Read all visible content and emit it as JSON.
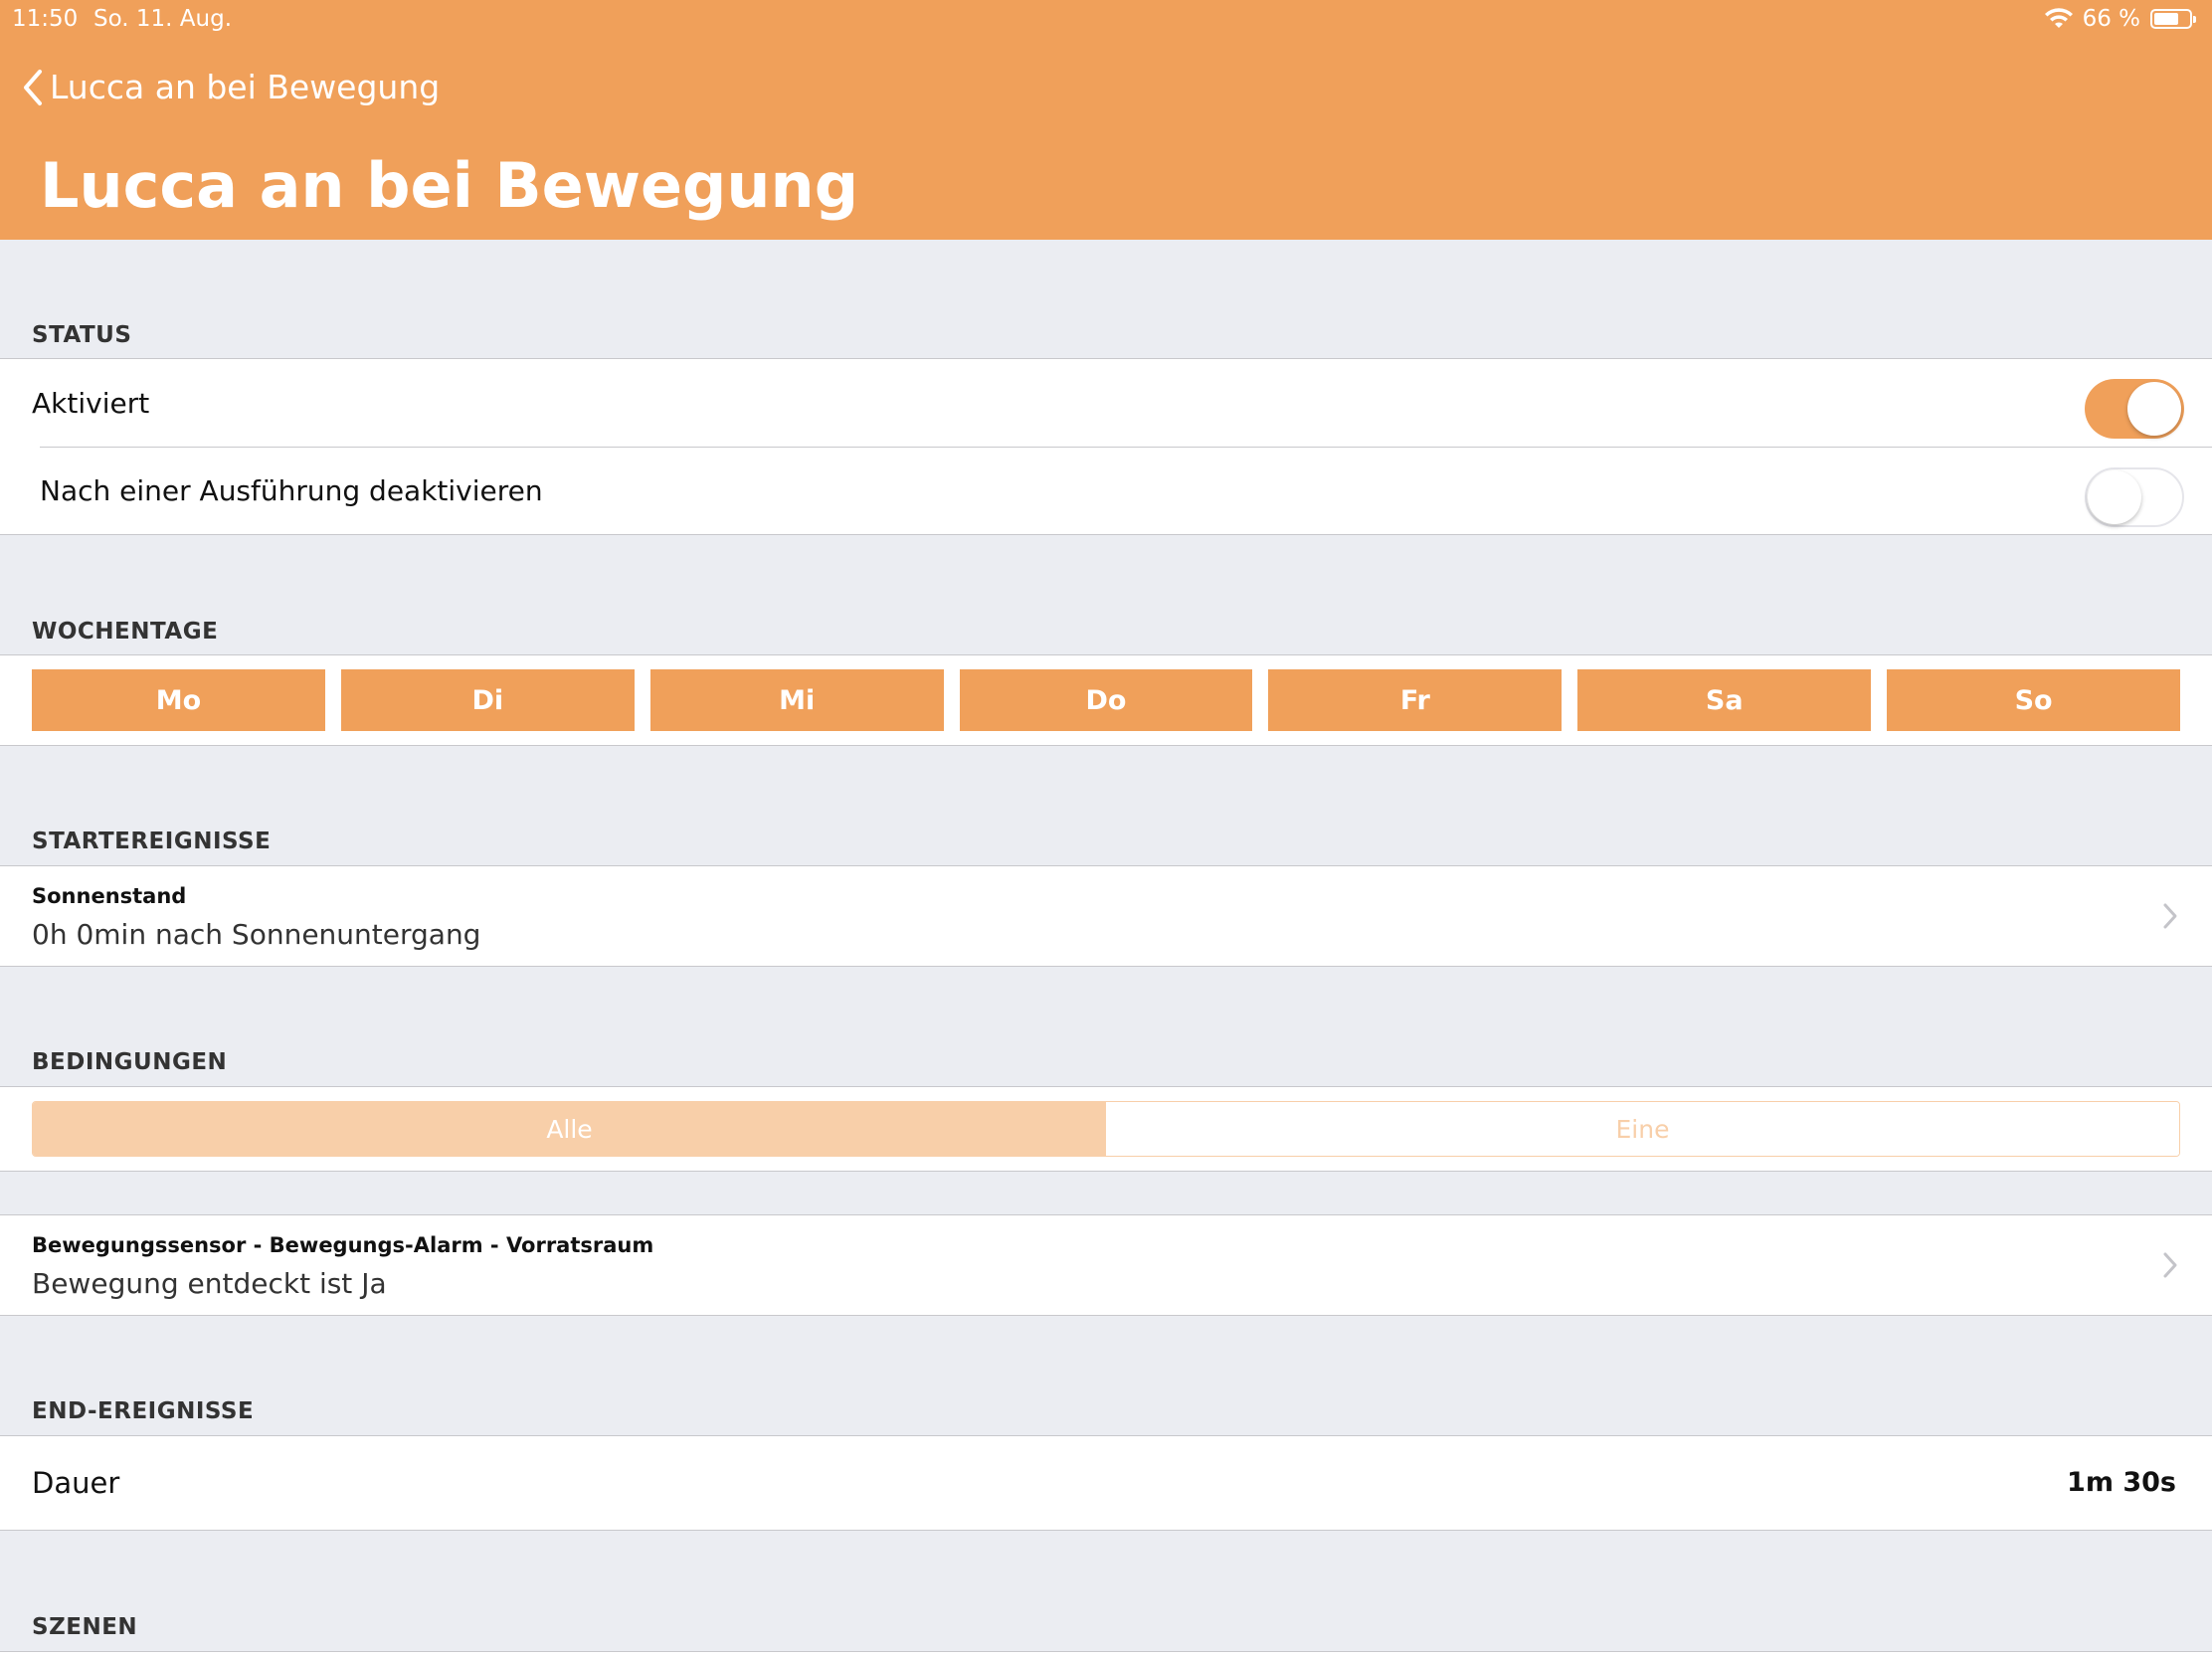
{
  "status_bar": {
    "time": "11:50",
    "date": "So. 11. Aug.",
    "battery": "66 %",
    "battery_level": 0.66
  },
  "nav": {
    "back_label": "Lucca an bei Bewegung",
    "title": "Lucca an bei Bewegung"
  },
  "status": {
    "header": "STATUS",
    "rows": [
      {
        "label": "Aktiviert",
        "on": true
      },
      {
        "label": "Nach einer Ausführung deaktivieren",
        "on": false
      }
    ]
  },
  "weekdays": {
    "header": "WOCHENTAGE",
    "days": [
      "Mo",
      "Di",
      "Mi",
      "Do",
      "Fr",
      "Sa",
      "So"
    ]
  },
  "start_events": {
    "header": "STARTEREIGNISSE",
    "item": {
      "title": "Sonnenstand",
      "subtitle": "0h 0min nach Sonnenuntergang"
    }
  },
  "conditions": {
    "header": "BEDINGUNGEN",
    "segments": [
      "Alle",
      "Eine"
    ],
    "selected": "Alle",
    "item": {
      "title": "Bewegungssensor - Bewegungs-Alarm - Vorratsraum",
      "subtitle": "Bewegung entdeckt ist Ja"
    }
  },
  "end_events": {
    "header": "END-EREIGNISSE",
    "item": {
      "label": "Dauer",
      "value": "1m 30s"
    }
  },
  "scenes": {
    "header": "SZENEN"
  },
  "colors": {
    "accent": "#f0a05a",
    "accent_light": "#f8cfa9",
    "background": "#ebedf2"
  }
}
